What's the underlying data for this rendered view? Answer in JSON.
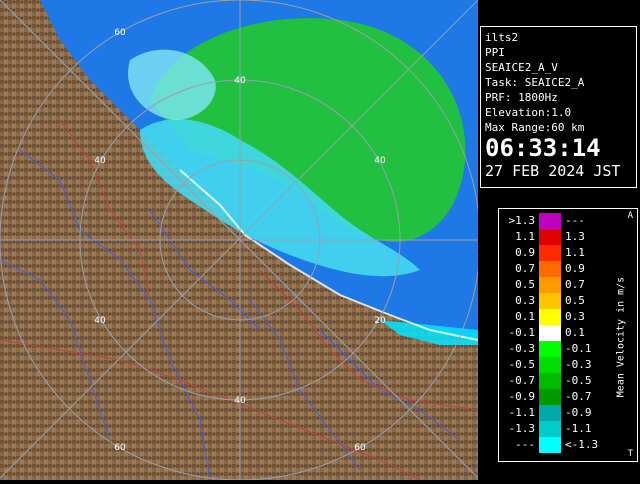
{
  "info": {
    "station": "ilts2",
    "scan_type": "PPI",
    "product": "SEAICE2_A_V",
    "task": "Task: SEAICE2_A",
    "prf": "PRF: 1800Hz",
    "elevation": "Elevation:1.0",
    "max_range": "Max Range:60 km",
    "time": "06:33:14",
    "date": "27 FEB 2024 JST"
  },
  "legend": {
    "unit_label": "Mean Velocity in m/s",
    "top_mark": "A",
    "bottom_mark": "T",
    "rows": [
      {
        "left": ">1.3",
        "right": "---",
        "color": "#c000c0"
      },
      {
        "left": "1.1",
        "right": "1.3",
        "color": "#e00000"
      },
      {
        "left": "0.9",
        "right": "1.1",
        "color": "#ff2a00"
      },
      {
        "left": "0.7",
        "right": "0.9",
        "color": "#ff6a00"
      },
      {
        "left": "0.5",
        "right": "0.7",
        "color": "#ff9900"
      },
      {
        "left": "0.3",
        "right": "0.5",
        "color": "#ffc400"
      },
      {
        "left": "0.1",
        "right": "0.3",
        "color": "#ffff00"
      },
      {
        "left": "-0.1",
        "right": "0.1",
        "color": "#ffffff"
      },
      {
        "left": "-0.3",
        "right": "-0.1",
        "color": "#00ff00"
      },
      {
        "left": "-0.5",
        "right": "-0.3",
        "color": "#00dd00"
      },
      {
        "left": "-0.7",
        "right": "-0.5",
        "color": "#00bb00"
      },
      {
        "left": "-0.9",
        "right": "-0.7",
        "color": "#009900"
      },
      {
        "left": "-1.1",
        "right": "-0.9",
        "color": "#00aaaa"
      },
      {
        "left": "-1.3",
        "right": "-1.1",
        "color": "#00cccc"
      },
      {
        "left": "---",
        "right": "<-1.3",
        "color": "#00ffff"
      }
    ]
  },
  "map": {
    "range_labels": [
      "20",
      "40",
      "40",
      "40",
      "40",
      "60",
      "60",
      "60"
    ],
    "colors": {
      "sea": "#1e78e6",
      "land": "#8a6a48",
      "rings": "#9aa0a8",
      "rivers": "#4a5ad8",
      "borders": "#c04040"
    }
  }
}
